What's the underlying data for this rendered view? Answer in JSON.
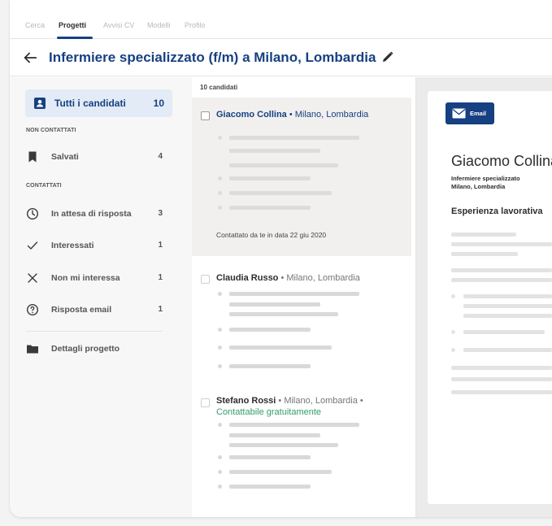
{
  "nav": {
    "tabs": [
      {
        "label": "Cerca"
      },
      {
        "label": "Progetti"
      },
      {
        "label": "Avvisi CV"
      },
      {
        "label": "Modelli"
      },
      {
        "label": "Profilo"
      }
    ],
    "active_tab": "Progetti"
  },
  "header": {
    "title": "Infermiere specializzato (f/m) a Milano, Lombardia",
    "back_icon": "arrow-left-icon",
    "edit_icon": "pencil-icon"
  },
  "sidebar": {
    "all": {
      "label": "Tutti i candidati",
      "count": "10",
      "icon": "person-badge-icon"
    },
    "sections": {
      "not_contacted": "NON CONTATTATI",
      "contacted": "CONTATTATI"
    },
    "saved": {
      "label": "Salvati",
      "count": "4",
      "icon": "bookmark-icon"
    },
    "pending": {
      "label": "In attesa di risposta",
      "count": "3",
      "icon": "clock-icon"
    },
    "interested": {
      "label": "Interessati",
      "count": "1",
      "icon": "check-icon"
    },
    "not_interested": {
      "label": "Non mi interessa",
      "count": "1",
      "icon": "close-icon"
    },
    "email_reply": {
      "label": "Risposta email",
      "count": "1",
      "icon": "question-circle-icon"
    },
    "details": {
      "label": "Dettagli progetto",
      "icon": "folder-icon"
    }
  },
  "list": {
    "count_label": "10 candidati",
    "candidates": [
      {
        "name": "Giacomo Collina",
        "location": " • Milano, Lombardia",
        "contacted": "Contattato da te in data 22 giu 2020"
      },
      {
        "name": "Claudia Russo",
        "location": " • Milano, Lombardia"
      },
      {
        "name": "Stefano Rossi",
        "location": " • Milano, Lombardia •",
        "free": "Contattabile gratuitamente"
      }
    ]
  },
  "preview": {
    "email_label": "Email",
    "email_icon": "envelope-icon",
    "name": "Giacomo Collina",
    "role": "Infermiere specializzato",
    "location": "Milano, Lombardia",
    "section": "Esperienza lavorativa"
  },
  "colors": {
    "brand": "#164081",
    "green": "#2f9e6a",
    "selected_bg": "#e3ebf6"
  }
}
